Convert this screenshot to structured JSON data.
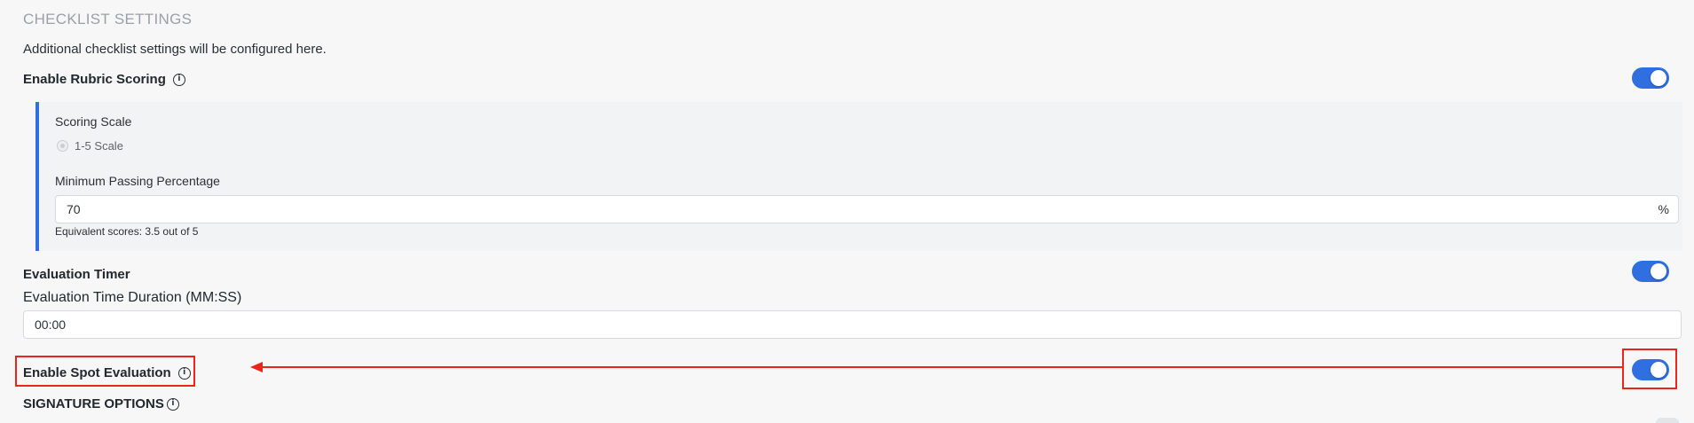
{
  "section": {
    "title": "CHECKLIST SETTINGS",
    "description": "Additional checklist settings will be configured here."
  },
  "rubric": {
    "label": "Enable Rubric Scoring",
    "enabled": true,
    "scoring_scale_label": "Scoring Scale",
    "scale_option": "1-5 Scale",
    "min_passing_label": "Minimum Passing Percentage",
    "min_passing_value": "70",
    "min_passing_suffix": "%",
    "equivalent_text": "Equivalent scores: 3.5 out of 5"
  },
  "timer": {
    "label": "Evaluation Timer",
    "enabled": true,
    "duration_label": "Evaluation Time Duration (MM:SS)",
    "duration_value": "00:00"
  },
  "spot": {
    "label": "Enable Spot Evaluation",
    "enabled": true
  },
  "signature": {
    "label": "SIGNATURE OPTIONS"
  },
  "icons": {
    "info": "info-icon"
  },
  "colors": {
    "accent": "#2f6fe0",
    "annotation": "#e8261c",
    "muted_heading": "#9aa0a8"
  }
}
